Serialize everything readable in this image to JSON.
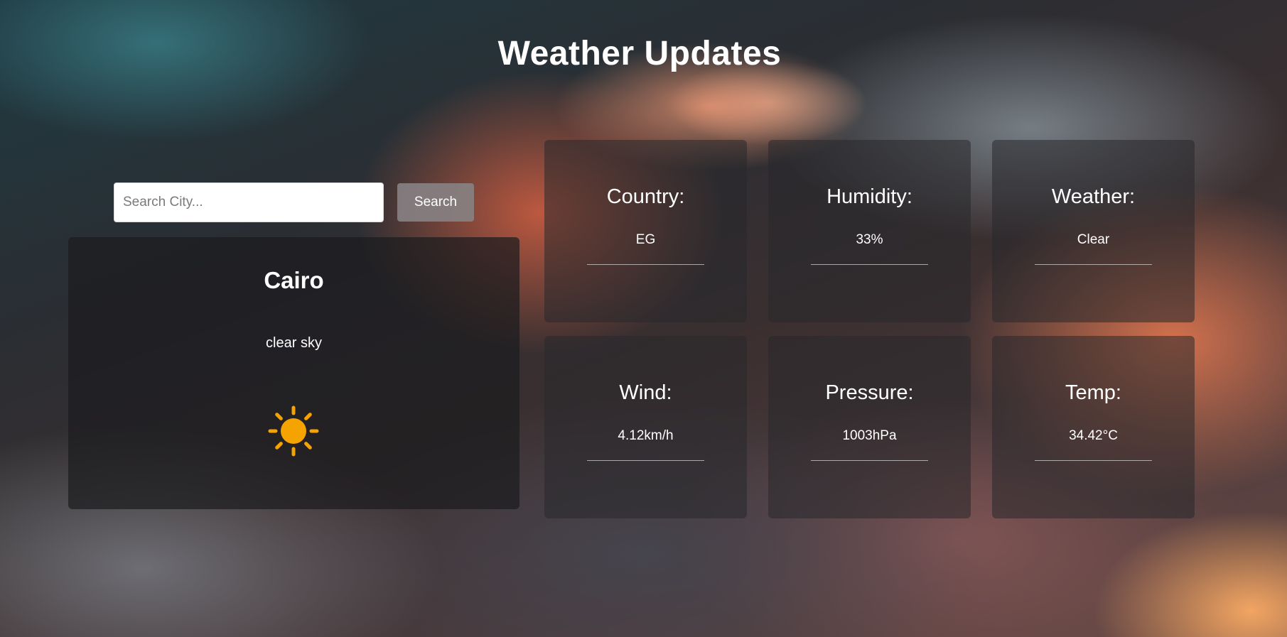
{
  "header": {
    "title": "Weather Updates"
  },
  "search": {
    "placeholder": "Search City...",
    "value": "",
    "button_label": "Search"
  },
  "current": {
    "city": "Cairo",
    "description": "clear sky",
    "icon": "sun-icon",
    "icon_color": "#f5a300"
  },
  "stats": [
    {
      "label": "Country:",
      "value": "EG"
    },
    {
      "label": "Humidity:",
      "value": "33%"
    },
    {
      "label": "Weather:",
      "value": "Clear"
    },
    {
      "label": "Wind:",
      "value": "4.12km/h"
    },
    {
      "label": "Pressure:",
      "value": "1003hPa"
    },
    {
      "label": "Temp:",
      "value": "34.42°C"
    }
  ]
}
